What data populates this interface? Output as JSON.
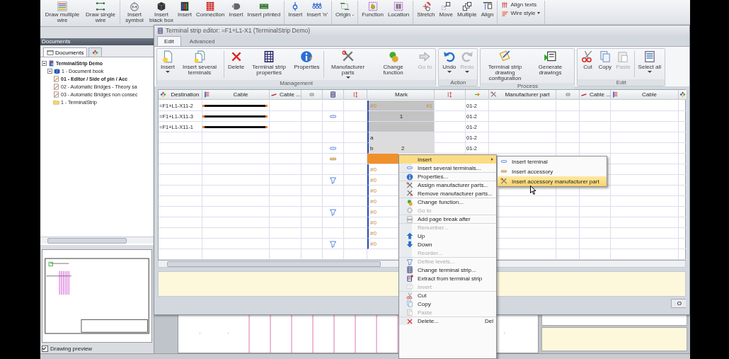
{
  "app_ribbon": {
    "groups": [
      {
        "buttons": [
          {
            "label": "Draw multiple wire"
          },
          {
            "label": "Draw single wire"
          }
        ]
      },
      {
        "buttons": [
          {
            "label": "Insert symbol"
          },
          {
            "label": "Insert black box"
          },
          {
            "label": "Insert"
          },
          {
            "label": "Connection"
          },
          {
            "label": "Insert"
          },
          {
            "label": "Insert printed"
          }
        ]
      },
      {
        "buttons": [
          {
            "label": "Insert"
          },
          {
            "label": "Insert 'n'"
          }
        ]
      },
      {
        "buttons": [
          {
            "label": "Origin -"
          }
        ]
      },
      {
        "buttons": [
          {
            "label": "Function"
          },
          {
            "label": "Location"
          }
        ]
      },
      {
        "buttons": [
          {
            "label": "Stretch"
          },
          {
            "label": "Move"
          },
          {
            "label": "Multiple"
          },
          {
            "label": "Align"
          }
        ]
      },
      {
        "small_buttons": [
          {
            "label": "Align texts",
            "dropdown": false
          },
          {
            "label": "Wire style",
            "dropdown": true
          }
        ]
      }
    ]
  },
  "documents_panel": {
    "title": "Documents",
    "tabs": [
      {
        "label": "Documents",
        "selected": true
      },
      {
        "selected": false
      }
    ],
    "tree": [
      {
        "label": "TerminalStrip Demo",
        "kind": "project",
        "bold": true,
        "expanded": true,
        "children": [
          {
            "label": "1 - Document book",
            "kind": "book",
            "bold": false,
            "expanded": true,
            "children": [
              {
                "label": "01 - Editor /  Side of pin / Acc",
                "kind": "drawing",
                "bold": true
              },
              {
                "label": "02 - Automatic Bridges - Theory sa",
                "kind": "drawing",
                "bold": false
              },
              {
                "label": "03 - Automatic Bridges non consec",
                "kind": "drawing",
                "bold": false
              },
              {
                "label": "1 - TerminalStrip",
                "kind": "folder",
                "bold": false
              }
            ]
          }
        ]
      }
    ],
    "preview_checkbox": {
      "label": "Drawing preview",
      "checked": true
    }
  },
  "terminal_strip_editor": {
    "title": "Terminal strip editor: =F1+L1-X1 (TerminalStrip Demo)",
    "tabs": [
      {
        "label": "Edit",
        "selected": true
      },
      {
        "label": "Advanced",
        "selected": false
      }
    ],
    "ribbon_groups": [
      {
        "label": "Management",
        "buttons": [
          {
            "label": "Insert",
            "dropdown": true,
            "disabled": false,
            "separator_before": false
          },
          {
            "label": "Insert several terminals",
            "dropdown": false,
            "disabled": false,
            "separator_before": false
          },
          {
            "label": "Delete",
            "dropdown": false,
            "disabled": false,
            "separator_before": true
          },
          {
            "label": "Terminal strip properties",
            "dropdown": false,
            "disabled": false,
            "separator_before": false
          },
          {
            "label": "Properties",
            "dropdown": false,
            "disabled": false,
            "separator_before": false
          },
          {
            "label": "Manufacturer parts",
            "dropdown": true,
            "disabled": false,
            "separator_before": true
          },
          {
            "label": "Change function",
            "dropdown": false,
            "disabled": false,
            "separator_before": false
          },
          {
            "label": "Go to",
            "dropdown": false,
            "disabled": true,
            "separator_before": false
          }
        ]
      },
      {
        "label": "Action",
        "buttons": [
          {
            "label": "Undo",
            "dropdown": true,
            "disabled": false,
            "separator_before": false
          },
          {
            "label": "Redo",
            "dropdown": true,
            "disabled": true,
            "separator_before": false
          }
        ]
      },
      {
        "label": "Process",
        "buttons": [
          {
            "label": "Terminal strip drawing configuration",
            "dropdown": false,
            "disabled": false,
            "separator_before": false
          },
          {
            "label": "Generate drawings",
            "dropdown": false,
            "disabled": false,
            "separator_before": false
          }
        ]
      },
      {
        "label": "Edit",
        "buttons": [
          {
            "label": "Cut",
            "dropdown": false,
            "disabled": false,
            "separator_before": false
          },
          {
            "label": "Copy",
            "dropdown": false,
            "disabled": false,
            "separator_before": false
          },
          {
            "label": "Paste",
            "dropdown": false,
            "disabled": true,
            "separator_before": false
          },
          {
            "label": "Select all",
            "dropdown": true,
            "disabled": false,
            "separator_before": true
          }
        ]
      }
    ],
    "table": {
      "columns": [
        {
          "kind": "text",
          "label": "Destination"
        },
        {
          "kind": "text",
          "label": "Cable"
        },
        {
          "kind": "text",
          "label": "Cable ..."
        },
        {
          "kind": "icon"
        },
        {
          "kind": "icon"
        },
        {
          "kind": "icon"
        },
        {
          "kind": "text",
          "label": "Mark"
        },
        {
          "kind": "icon"
        },
        {
          "kind": "icon"
        },
        {
          "kind": "text",
          "label": "Manufacturer part"
        },
        {
          "kind": "icon"
        },
        {
          "kind": "text",
          "label": "Cable ..."
        },
        {
          "kind": "text",
          "label": "Cable"
        },
        {
          "kind": "icon"
        }
      ],
      "rows": [
        {
          "destination": "=F1+L1-X11-2",
          "cable": true,
          "mark_cell": {
            "kind": "dark",
            "tag_left": "#0",
            "tag_right": "#1"
          },
          "column_9": "01-2",
          "selected": false
        },
        {
          "destination": "=F1+L1-X11-3",
          "cable": true,
          "symbol": {
            "kind": "terminal"
          },
          "mark_cell": {
            "kind": "dark",
            "value": "1"
          },
          "column_9": "01-2",
          "selected": false
        },
        {
          "destination": "=F1+L1-X11-1",
          "cable": true,
          "mark_cell": {
            "kind": "dark"
          },
          "column_9": "01-2",
          "selected": false
        },
        {
          "cable": false,
          "mark_cell": {
            "kind": "light",
            "tag_left": "a"
          },
          "column_9": "01-2",
          "selected": false
        },
        {
          "cable": false,
          "symbol": {
            "kind": "terminal"
          },
          "mark_cell": {
            "kind": "light",
            "tag_left": "b",
            "value": "2"
          },
          "column_9": "01-2",
          "selected": false
        },
        {
          "cable": false,
          "symbol": {
            "kind": "accessory"
          },
          "mark_cell": {
            "kind": "plain"
          },
          "selected": true
        },
        {
          "cable": false,
          "mark_cell": {
            "kind": "bracket",
            "tag_left": "#0"
          },
          "selected": false
        },
        {
          "cable": false,
          "symbol": {
            "kind": "level"
          },
          "mark_cell": {
            "kind": "bracket",
            "tag_left": "#0"
          },
          "selected": false
        },
        {
          "cable": false,
          "mark_cell": {
            "kind": "bracket",
            "tag_left": "#0"
          },
          "selected": false
        },
        {
          "cable": false,
          "mark_cell": {
            "kind": "bracket",
            "tag_left": "#0"
          },
          "selected": false
        },
        {
          "cable": false,
          "symbol": {
            "kind": "level"
          },
          "mark_cell": {
            "kind": "bracket",
            "tag_left": "#0"
          },
          "selected": false
        },
        {
          "cable": false,
          "mark_cell": {
            "kind": "bracket",
            "tag_left": "#0"
          },
          "selected": false
        },
        {
          "cable": false,
          "mark_cell": {
            "kind": "bracket",
            "tag_left": "#0"
          },
          "selected": false
        },
        {
          "cable": false,
          "symbol": {
            "kind": "level"
          },
          "mark_cell": {
            "kind": "bracket",
            "tag_left": "#0"
          },
          "selected": false
        },
        {
          "cable": false,
          "mark_cell": {
            "kind": "plain"
          },
          "selected": false
        }
      ]
    },
    "footer_button": "O"
  },
  "context_menu": {
    "items": [
      {
        "label": "Insert",
        "selected": true,
        "disabled": false,
        "submenu": true,
        "separator_before": false
      },
      {
        "label": "Insert several terminals...",
        "selected": false,
        "disabled": false,
        "submenu": false,
        "separator_before": false
      },
      {
        "label": "Properties...",
        "selected": false,
        "disabled": false,
        "submenu": false,
        "separator_before": true
      },
      {
        "label": "Assign manufacturer parts...",
        "selected": false,
        "disabled": false,
        "submenu": false,
        "separator_before": true
      },
      {
        "label": "Remove manufacturer parts...",
        "selected": false,
        "disabled": false,
        "submenu": false,
        "separator_before": false
      },
      {
        "label": "Change function...",
        "selected": false,
        "disabled": false,
        "submenu": false,
        "separator_before": true
      },
      {
        "label": "Go to",
        "selected": false,
        "disabled": true,
        "submenu": false,
        "separator_before": false
      },
      {
        "label": "Add page break after",
        "selected": false,
        "disabled": false,
        "submenu": false,
        "separator_before": true
      },
      {
        "label": "Renumber...",
        "selected": false,
        "disabled": true,
        "submenu": false,
        "separator_before": true
      },
      {
        "label": "Up",
        "selected": false,
        "disabled": false,
        "submenu": false,
        "separator_before": false
      },
      {
        "label": "Down",
        "selected": false,
        "disabled": false,
        "submenu": false,
        "separator_before": false
      },
      {
        "label": "Reorder...",
        "selected": false,
        "disabled": true,
        "submenu": false,
        "separator_before": false
      },
      {
        "label": "Define levels...",
        "selected": false,
        "disabled": true,
        "submenu": false,
        "separator_before": true
      },
      {
        "label": "Change terminal strip...",
        "selected": false,
        "disabled": false,
        "submenu": false,
        "separator_before": false
      },
      {
        "label": "Extract from terminal strip",
        "selected": false,
        "disabled": false,
        "submenu": false,
        "separator_before": false
      },
      {
        "label": "Invert",
        "selected": false,
        "disabled": true,
        "submenu": false,
        "separator_before": false
      },
      {
        "label": "Cut",
        "selected": false,
        "disabled": false,
        "submenu": false,
        "separator_before": true
      },
      {
        "label": "Copy",
        "selected": false,
        "disabled": false,
        "submenu": false,
        "separator_before": false
      },
      {
        "label": "Paste",
        "selected": false,
        "disabled": true,
        "submenu": false,
        "separator_before": false
      },
      {
        "label": "Delete...",
        "shortcut": "Del",
        "selected": false,
        "disabled": false,
        "submenu": false,
        "separator_before": true
      }
    ]
  },
  "submenu": {
    "items": [
      {
        "label": "Insert terminal",
        "selected": false
      },
      {
        "label": "Insert accessory",
        "selected": false
      },
      {
        "label": "Insert accessory manufacturer part",
        "selected": true
      }
    ]
  }
}
